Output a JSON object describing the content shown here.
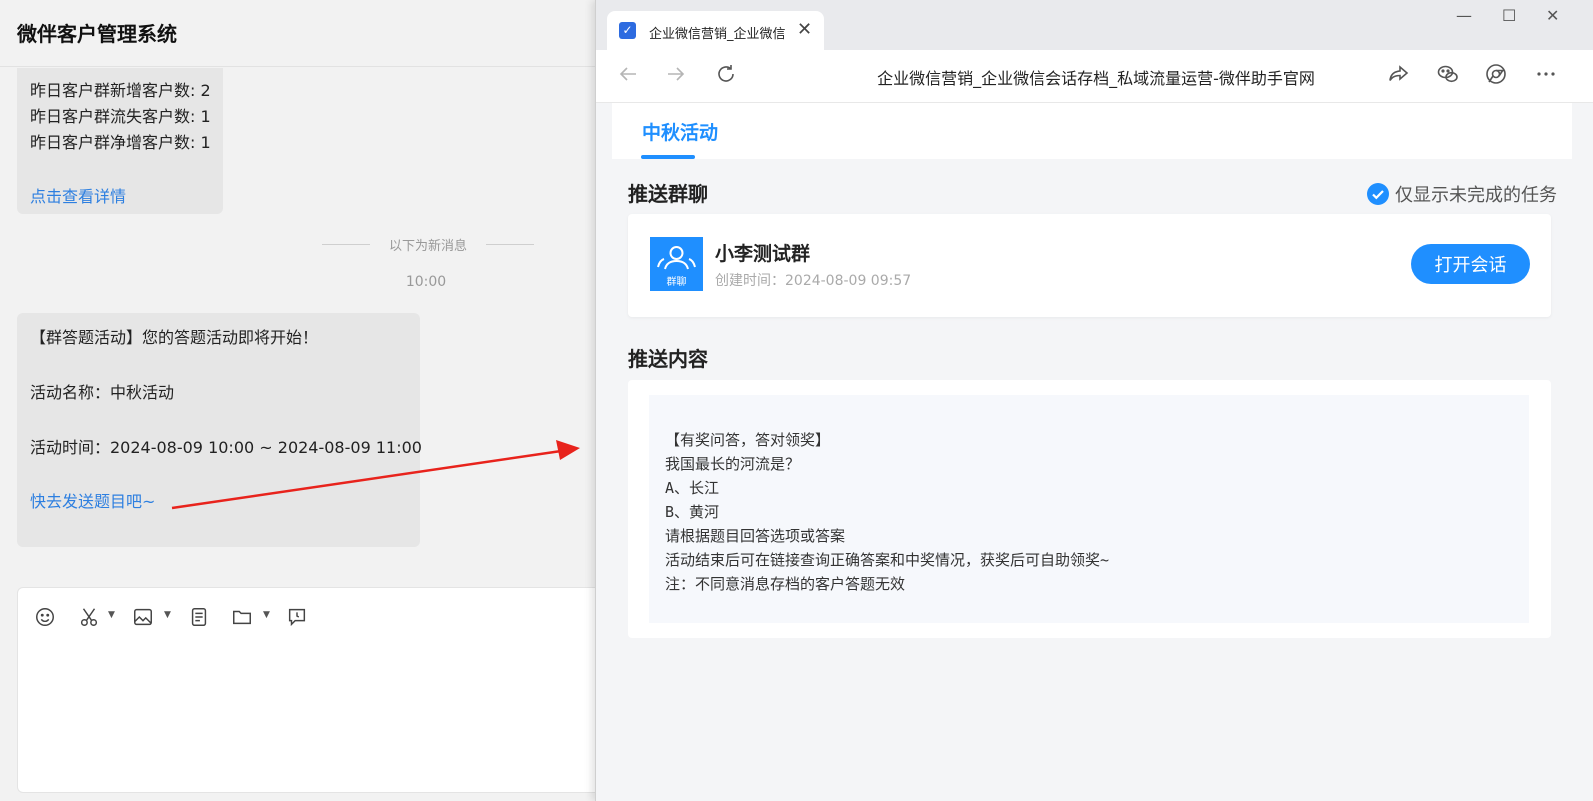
{
  "chat": {
    "app_title": "微伴客户管理系统",
    "bubble1": {
      "lines": [
        "昨日客户群新增客户数: 2",
        "昨日客户群流失客户数: 1",
        "昨日客户群净增客户数: 1"
      ],
      "link": "点击查看详情"
    },
    "system_divider": "以下为新消息",
    "time": "10:00",
    "bubble2": {
      "heading": "【群答题活动】您的答题活动即将开始！",
      "activity_name": "活动名称：中秋活动",
      "activity_time": "活动时间：2024-08-09 10:00 ~ 2024-08-09 11:00",
      "link": "快去发送题目吧~"
    },
    "toolbar_icons": [
      "emoji-icon",
      "scissors-icon",
      "image-icon",
      "document-icon",
      "folder-icon",
      "chat-history-icon"
    ]
  },
  "browser": {
    "tab_title": "企业微信营销_企业微信",
    "tab_close": "✕",
    "window_controls": [
      "—",
      "☐",
      "✕"
    ],
    "address": "企业微信营销_企业微信会话存档_私域流量运营-微伴助手官网",
    "page": {
      "top_tab": "中秋活动",
      "push_group_title": "推送群聊",
      "only_incomplete_label": "仅显示未完成的任务",
      "group": {
        "avatar_label": "群聊",
        "name": "小李测试群",
        "created": "创建时间：2024-08-09 09:57",
        "open_button": "打开会话"
      },
      "push_content_title": "推送内容",
      "content_lines": [
        "【有奖问答，答对领奖】",
        "我国最长的河流是？",
        "A、长江",
        "B、黄河",
        "请根据题目回答选项或答案",
        "活动结束后可在链接查询正确答案和中奖情况，获奖后可自助领奖~",
        "注：不同意消息存档的客户答题无效"
      ]
    }
  },
  "colors": {
    "accent": "#1f8fff",
    "link": "#2d7fe0",
    "annotation_arrow": "#e8231c"
  }
}
